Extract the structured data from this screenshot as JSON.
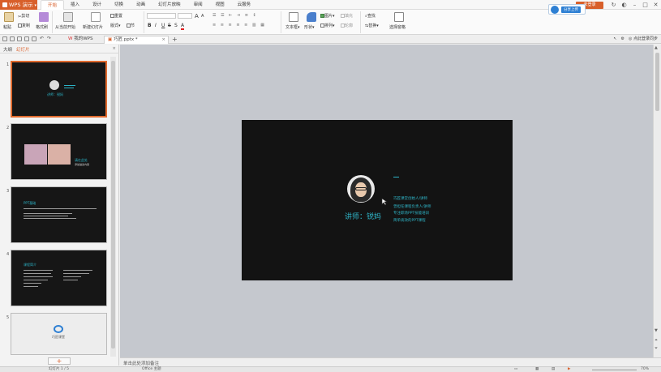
{
  "app": {
    "name": "WPS 演示"
  },
  "menu": [
    "开始",
    "插入",
    "设计",
    "切换",
    "动画",
    "幻灯片放映",
    "审阅",
    "视图",
    "云服务"
  ],
  "window": {
    "user_label": "未登录",
    "minimize": "–",
    "restore": "□",
    "close": "✕"
  },
  "share": {
    "label": "分享上传"
  },
  "ribbon": {
    "paste": "粘贴",
    "cut": "剪切",
    "copy": "复制",
    "format_painter": "格式刷",
    "from_current": "从当前开始",
    "new_slide": "新建幻灯片",
    "layout": "版式",
    "section": "节",
    "reset": "重置",
    "bold": "B",
    "italic": "I",
    "underline": "U",
    "strike": "S",
    "shadow": "S",
    "font_color": "A",
    "grow_font": "A",
    "shrink_font": "A",
    "textbox": "文本框",
    "shape": "形状",
    "picture": "图片",
    "arrange": "排列",
    "fill": "填充",
    "outline": "轮廓",
    "find": "查找",
    "replace": "替换",
    "select_pane": "选择窗格"
  },
  "tabs": {
    "wps": "我的WPS",
    "file": "巧匠.pptx *",
    "add": "+",
    "login_text": "点此登录同步"
  },
  "panel": {
    "outline": "大纲",
    "slides": "幻灯片",
    "close": "×",
    "add_button": "+"
  },
  "thumbs": {
    "t1": {
      "num": "1",
      "title": "讲师：锐妈"
    },
    "t2": {
      "num": "2",
      "title": "请在此处",
      "sub": "添加描述内容"
    },
    "t3": {
      "num": "3",
      "title": "PPT基础"
    },
    "t4": {
      "num": "4",
      "title": "课程简介"
    },
    "t5": {
      "num": "5",
      "brand": "巧匠课堂"
    }
  },
  "slide": {
    "lecturer": "讲师：锐妈",
    "dash": "一",
    "lines": [
      "巧匠课堂创始人/讲师",
      "曾担任课程负责人/讲师",
      "专注职场PPT技能培训",
      "简单高效的PPT课程"
    ]
  },
  "notes": {
    "placeholder": "单击此处添加备注"
  },
  "status": {
    "slide_info": "幻灯片 1 / 5",
    "theme": "Office 主题",
    "zoom": "70%"
  },
  "colors": {
    "accent": "#d85f2a",
    "slide_text": "#2fb5c8",
    "slide_bg": "#131313",
    "canvas": "#c5c8ce"
  }
}
